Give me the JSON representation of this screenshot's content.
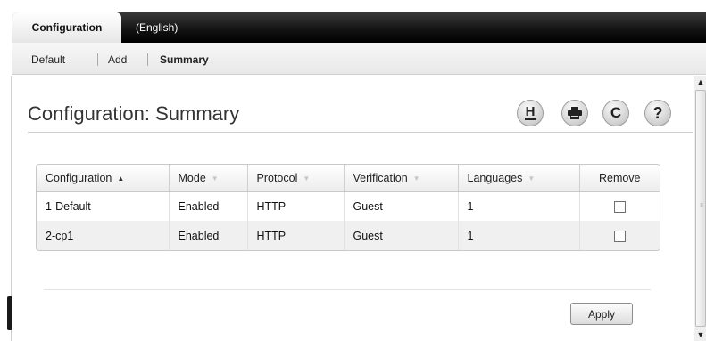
{
  "tabs": {
    "active": "Configuration",
    "inactive": "(English)"
  },
  "subnav": {
    "items": [
      "Default",
      "Add",
      "Summary"
    ],
    "active": "Summary"
  },
  "page": {
    "title": "Configuration: Summary"
  },
  "toolbar": {
    "icons": [
      "save-icon",
      "print-icon",
      "refresh-icon",
      "help-icon"
    ],
    "save_glyph": "H",
    "refresh_glyph": "C",
    "help_glyph": "?"
  },
  "table": {
    "headers": [
      "Configuration",
      "Mode",
      "Protocol",
      "Verification",
      "Languages",
      "Remove"
    ],
    "sort_indicator": "▲",
    "rows": [
      {
        "configuration": "1-Default",
        "mode": "Enabled",
        "protocol": "HTTP",
        "verification": "Guest",
        "languages": "1",
        "remove": false
      },
      {
        "configuration": "2-cp1",
        "mode": "Enabled",
        "protocol": "HTTP",
        "verification": "Guest",
        "languages": "1",
        "remove": false
      }
    ]
  },
  "actions": {
    "apply_label": "Apply"
  },
  "colors": {
    "tabbar": "#111111",
    "button_border": "#8e8e8e",
    "accent_text": "#222222"
  }
}
